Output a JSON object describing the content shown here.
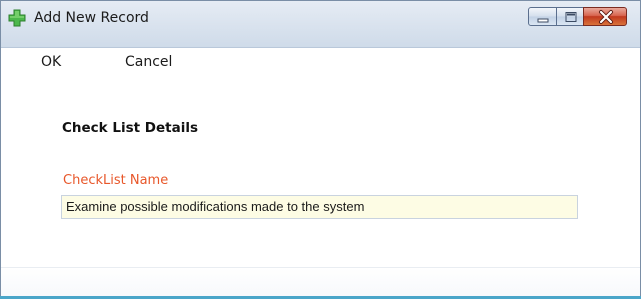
{
  "window": {
    "title": "Add New Record",
    "icon": "green-plus-icon",
    "controls": [
      "minimize-icon",
      "maximize-icon",
      "close-icon"
    ]
  },
  "menu": {
    "ok_label": "OK",
    "cancel_label": "Cancel"
  },
  "form": {
    "section_title": "Check List Details",
    "checklist_name_label": "CheckList Name",
    "checklist_name_value": "Examine possible modifications made to the system"
  },
  "colors": {
    "label_accent": "#e8572a",
    "input_background": "#fdfce4",
    "close_button": "#c1381f",
    "icon_green": "#3aa83a"
  }
}
